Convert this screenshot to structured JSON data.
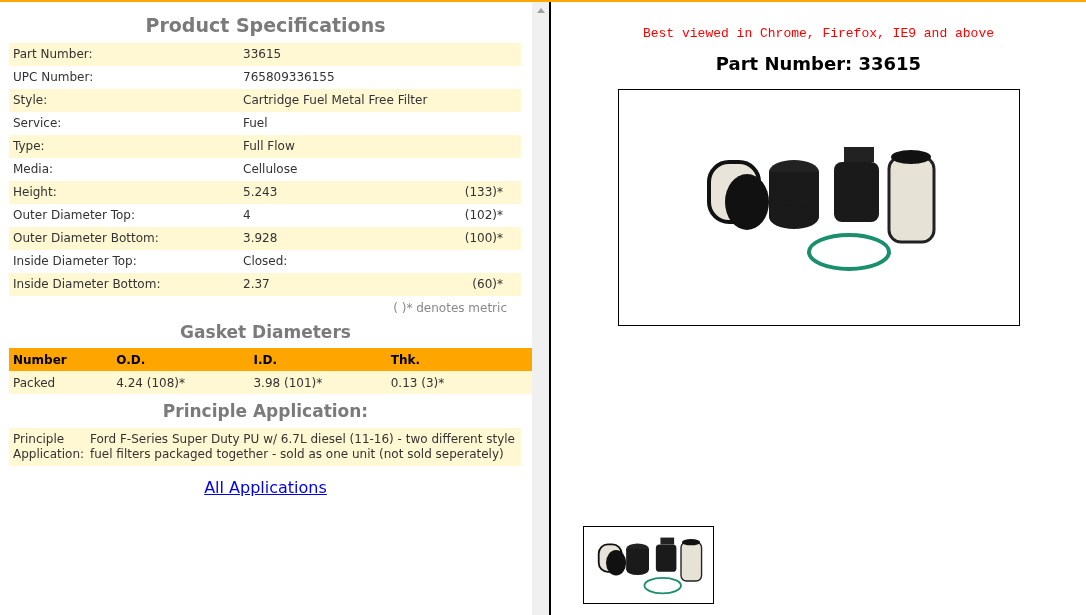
{
  "specs": {
    "title": "Product Specifications",
    "rows": [
      {
        "label": "Part Number:",
        "value": "33615"
      },
      {
        "label": "UPC Number:",
        "value": "765809336155"
      },
      {
        "label": "Style:",
        "value": "Cartridge Fuel Metal Free Filter"
      },
      {
        "label": "Service:",
        "value": "Fuel"
      },
      {
        "label": "Type:",
        "value": "Full Flow"
      },
      {
        "label": "Media:",
        "value": "Cellulose"
      },
      {
        "label": "Height:",
        "value": "5.243",
        "metric": "(133)*"
      },
      {
        "label": "Outer Diameter Top:",
        "value": "4",
        "metric": "(102)*"
      },
      {
        "label": "Outer Diameter Bottom:",
        "value": "3.928",
        "metric": "(100)*"
      },
      {
        "label": "Inside Diameter Top:",
        "value": "Closed:"
      },
      {
        "label": "Inside Diameter Bottom:",
        "value": "2.37",
        "metric": "(60)*"
      }
    ],
    "note": "(  )* denotes metric"
  },
  "gaskets": {
    "title": "Gasket Diameters",
    "columns": [
      "Number",
      "O.D.",
      "I.D.",
      "Thk."
    ],
    "rows": [
      [
        "Packed",
        "4.24 (108)*",
        "3.98 (101)*",
        "0.13 (3)*"
      ]
    ]
  },
  "application": {
    "title": "Principle Application:",
    "label": "Principle Application:",
    "text": "Ford F-Series Super Duty PU w/ 6.7L diesel (11-16) - two different style fuel filters packaged together - sold as one unit (not sold seperately)"
  },
  "all_applications_link": "All Applications",
  "browser_note": "Best viewed in Chrome, Firefox, IE9 and above",
  "part_heading": "Part Number: 33615"
}
